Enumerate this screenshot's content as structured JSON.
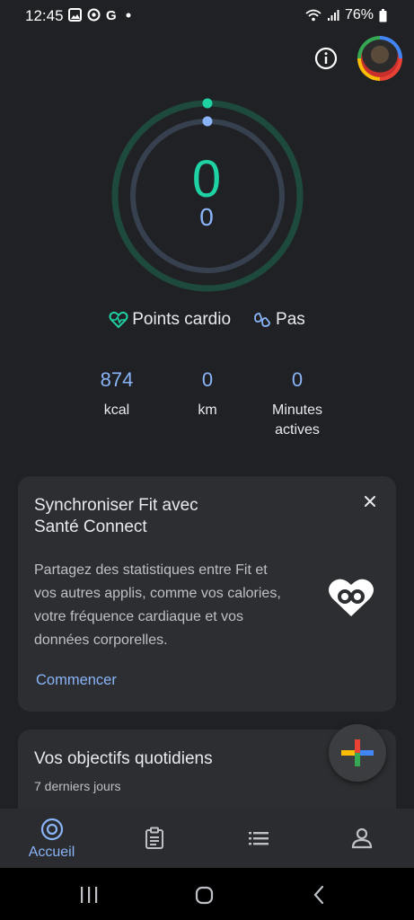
{
  "status_bar": {
    "time": "12:45",
    "battery": "76%"
  },
  "activity": {
    "heart_points_value": "0",
    "steps_value": "0",
    "legend": {
      "heart_points_label": "Points cardio",
      "steps_label": "Pas"
    },
    "colors": {
      "heart_points": "#1ed2a4",
      "steps": "#8ab4f8"
    }
  },
  "stats": [
    {
      "value": "874",
      "label": "kcal"
    },
    {
      "value": "0",
      "label": "km"
    },
    {
      "value": "0",
      "label_line1": "Minutes",
      "label_line2": "actives"
    }
  ],
  "sync_card": {
    "title_line1": "Synchroniser Fit avec",
    "title_line2": "Santé Connect",
    "body_line1": "Partagez des statistiques entre Fit et",
    "body_line2": "vos autres applis, comme vos calories,",
    "body_line3": "votre fréquence cardiaque et vos",
    "body_line4": "données corporelles.",
    "action": "Commencer"
  },
  "goals_card": {
    "title": "Vos objectifs quotidiens",
    "subtitle": "7 derniers jours"
  },
  "bottom_nav": {
    "home_label": "Accueil",
    "items": [
      "home-icon",
      "journal-icon",
      "browse-icon",
      "profile-icon"
    ]
  }
}
